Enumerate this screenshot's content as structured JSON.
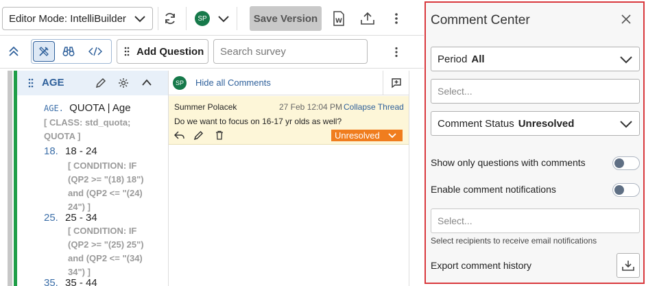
{
  "toolbar": {
    "mode_label": "Editor Mode: IntelliBuilder",
    "avatar_initials": "SP",
    "save_label": "Save Version"
  },
  "toolbar2": {
    "add_question_label": "Add Question",
    "search_placeholder": "Search survey"
  },
  "question": {
    "title": "AGE",
    "tag": "AGE.",
    "heading": "QUOTA | Age",
    "class_lines": [
      "[ CLASS: std_quota;",
      "QUOTA ]"
    ],
    "options": [
      {
        "num": "18.",
        "label": "18 - 24",
        "condition": [
          "[ CONDITION: IF",
          "(QP2 >= \"(18) 18\")",
          "and (QP2 <= \"(24)",
          "24\") ]"
        ]
      },
      {
        "num": "25.",
        "label": "25 - 34",
        "condition": [
          "[ CONDITION: IF",
          "(QP2 >= \"(25) 25\")",
          "and (QP2 <= \"(34)",
          "34\") ]"
        ]
      },
      {
        "num": "35.",
        "label": "35 - 44",
        "condition": []
      }
    ]
  },
  "comments": {
    "avatar_initials": "SP",
    "hide_all_label": "Hide all Comments",
    "thread": {
      "author": "Summer Polacek",
      "timestamp": "27 Feb 12:04 PM",
      "collapse_label": "Collapse Thread",
      "text": "Do we want to focus on 16-17 yr olds as well?",
      "status": "Unresolved",
      "status_color": "#f07d1e"
    }
  },
  "panel": {
    "title": "Comment Center",
    "period_label": "Period",
    "period_value": "All",
    "select_placeholder": "Select...",
    "status_label": "Comment Status",
    "status_value": "Unresolved",
    "toggle_only_questions": "Show only questions with comments",
    "toggle_notifications": "Enable comment notifications",
    "recipients_placeholder": "Select...",
    "recipients_help": "Select recipients to receive email notifications",
    "export_label": "Export comment history",
    "border_color": "#d9373c"
  }
}
